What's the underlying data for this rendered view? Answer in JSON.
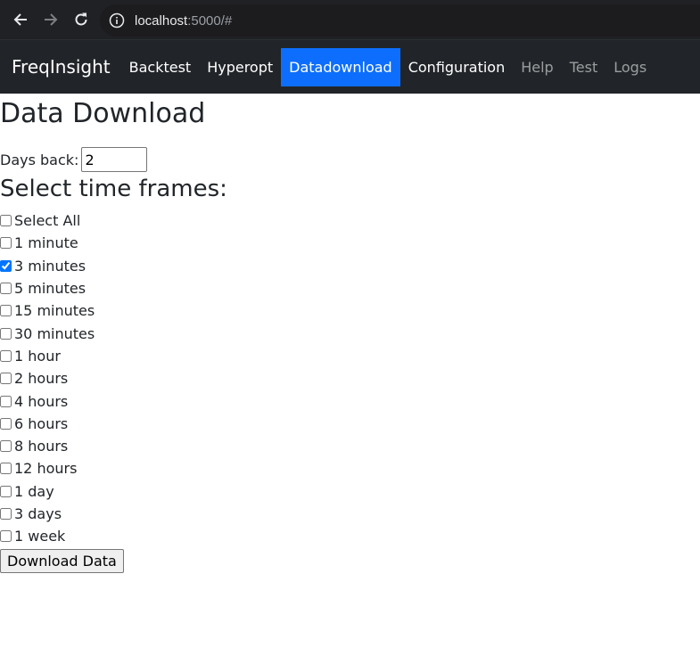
{
  "browser": {
    "url_host": "localhost",
    "url_rest": ":5000/#"
  },
  "nav": {
    "brand": "FreqInsight",
    "links": [
      {
        "label": "Backtest"
      },
      {
        "label": "Hyperopt"
      },
      {
        "label": "Datadownload"
      },
      {
        "label": "Configuration"
      },
      {
        "label": "Help"
      },
      {
        "label": "Test"
      },
      {
        "label": "Logs"
      }
    ]
  },
  "page": {
    "title": "Data Download",
    "days_back_label": "Days back:",
    "days_back_value": "2",
    "timeframes_heading": "Select time frames:",
    "options": [
      {
        "label": "Select All",
        "checked": false
      },
      {
        "label": "1 minute",
        "checked": false
      },
      {
        "label": "3 minutes",
        "checked": true
      },
      {
        "label": "5 minutes",
        "checked": false
      },
      {
        "label": "15 minutes",
        "checked": false
      },
      {
        "label": "30 minutes",
        "checked": false
      },
      {
        "label": "1 hour",
        "checked": false
      },
      {
        "label": "2 hours",
        "checked": false
      },
      {
        "label": "4 hours",
        "checked": false
      },
      {
        "label": "6 hours",
        "checked": false
      },
      {
        "label": "8 hours",
        "checked": false
      },
      {
        "label": "12 hours",
        "checked": false
      },
      {
        "label": "1 day",
        "checked": false
      },
      {
        "label": "3 days",
        "checked": false
      },
      {
        "label": "1 week",
        "checked": false
      }
    ],
    "download_button": "Download Data"
  },
  "colors": {
    "navbar_bg": "#212529",
    "active_link_bg": "#0d6efd"
  }
}
